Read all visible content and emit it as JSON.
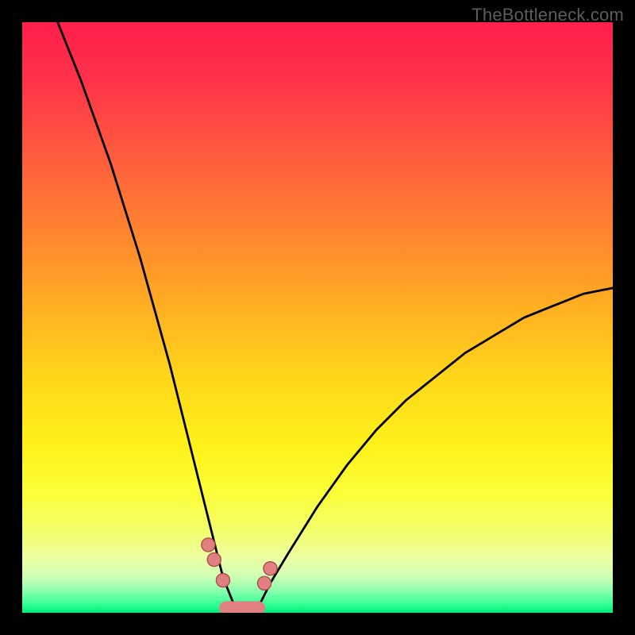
{
  "watermark": "TheBottleneck.com",
  "colors": {
    "bg": "#000000",
    "watermark": "#5c5c5c",
    "curve": "#000000",
    "marker_fill": "#e08080",
    "marker_stroke": "#a84c4c",
    "gradient_stops": [
      {
        "offset": 0.0,
        "color": "#ff1f4b"
      },
      {
        "offset": 0.1,
        "color": "#ff3349"
      },
      {
        "offset": 0.22,
        "color": "#ff5a3e"
      },
      {
        "offset": 0.35,
        "color": "#ff8230"
      },
      {
        "offset": 0.48,
        "color": "#ffae22"
      },
      {
        "offset": 0.6,
        "color": "#ffd61a"
      },
      {
        "offset": 0.72,
        "color": "#fff21a"
      },
      {
        "offset": 0.8,
        "color": "#fbff3a"
      },
      {
        "offset": 0.86,
        "color": "#f3ff6b"
      },
      {
        "offset": 0.905,
        "color": "#eeffa0"
      },
      {
        "offset": 0.935,
        "color": "#d4ffb4"
      },
      {
        "offset": 0.958,
        "color": "#9cffb0"
      },
      {
        "offset": 0.975,
        "color": "#5dffa0"
      },
      {
        "offset": 0.988,
        "color": "#2bff90"
      },
      {
        "offset": 1.0,
        "color": "#00e878"
      }
    ]
  },
  "chart_data": {
    "type": "line",
    "title": "",
    "xlabel": "",
    "ylabel": "",
    "xlim": [
      0,
      100
    ],
    "ylim": [
      0,
      100
    ],
    "description": "V-shaped bottleneck curve: y-axis is bottleneck percentage (100 at top = worst/red, 0 at bottom = best/green). The curve descends steeply from top-left, reaches zero bottleneck around x≈34–40, then rises more gently toward the right edge reaching roughly y≈55 at x=100.",
    "x": [
      6,
      10,
      15,
      20,
      25,
      28,
      30,
      32,
      34,
      36,
      38,
      40,
      42,
      45,
      50,
      55,
      60,
      65,
      70,
      75,
      80,
      85,
      90,
      95,
      100
    ],
    "y": [
      100,
      90,
      76,
      60,
      42,
      30,
      22,
      14,
      6,
      1,
      0,
      1,
      5,
      10,
      18,
      25,
      31,
      36,
      40,
      44,
      47,
      50,
      52,
      54,
      55
    ],
    "markers": {
      "comment": "Pink circular markers along the very bottom of the V, and a short pink segment at the trough.",
      "points_xy": [
        [
          31.5,
          11.5
        ],
        [
          32.5,
          9.0
        ],
        [
          34.0,
          5.5
        ],
        [
          41.0,
          5.0
        ],
        [
          42.0,
          7.5
        ]
      ],
      "bottom_segment_x": [
        34.5,
        40.0
      ],
      "bottom_segment_y": 0.8,
      "radius_pct": 1.15
    }
  }
}
